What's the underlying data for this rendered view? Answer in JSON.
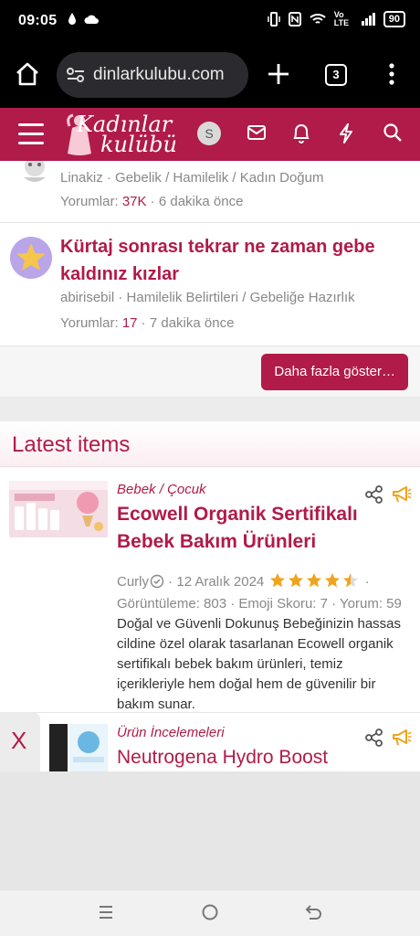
{
  "status_bar": {
    "time": "09:05",
    "network_label": "Vo LTE",
    "battery": "90"
  },
  "browser": {
    "url": "dinlarkulubu.com",
    "tab_count": "3"
  },
  "site": {
    "logo_line1": "Kadınlar",
    "logo_line2": "kulübü",
    "avatar_letter": "S"
  },
  "threads": [
    {
      "author": "Linakiz",
      "categories": "Gebelik / Hamilelik / Kadın Doğum",
      "comments_label": "Yorumlar:",
      "comments": "37K",
      "time": "6 dakika önce"
    },
    {
      "title": "Kürtaj sonrası tekrar ne zaman gebe kaldınız kızlar",
      "author": "abirisebil",
      "categories": "Hamilelik Belirtileri / Gebeliğe Hazırlık",
      "comments_label": "Yorumlar:",
      "comments": "17",
      "time": "7 dakika önce"
    }
  ],
  "show_more": "Daha fazla göster…",
  "latest": {
    "heading": "Latest items",
    "items": [
      {
        "category": "Bebek / Çocuk",
        "title": "Ecowell Organik Sertifikalı Bebek Bakım Ürünleri",
        "author": "Curly",
        "date": "12 Aralık 2024",
        "rating": 4.5,
        "views": "Görüntüleme: 803",
        "emoji_score": "Emoji Skoru: 7",
        "comments": "Yorum: 59",
        "description": "Doğal ve Güvenli Dokunuş Bebeğinizin hassas cildine özel olarak tasarlanan Ecowell organik sertifikalı bebek bakım ürünleri, temiz içerikleriyle hem doğal hem de güvenilir bir bakım sunar."
      },
      {
        "category": "Ürün İncelemeleri",
        "title": "Neutrogena Hydro Boost"
      }
    ]
  },
  "overlay": {
    "close_label": "X"
  },
  "colors": {
    "brand": "#b01b49",
    "star": "#f0a31e"
  }
}
